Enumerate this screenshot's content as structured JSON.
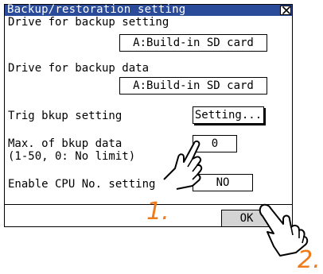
{
  "dialog": {
    "title": "Backup/restoration setting",
    "close_glyph": "×"
  },
  "settings": {
    "drive_backup_setting_label": "Drive for backup setting",
    "drive_backup_setting_value": "A:Build-in SD card",
    "drive_backup_data_label": "Drive for backup data",
    "drive_backup_data_value": "A:Build-in SD card",
    "trig_label": "Trig bkup setting",
    "trig_button": "Setting...",
    "max_label_line1": "Max. of bkup data",
    "max_label_line2": "(1-50, 0: No limit)",
    "max_value": "0",
    "enable_cpu_label": "Enable CPU No. setting",
    "enable_cpu_value": "NO"
  },
  "footer": {
    "ok_label": "OK"
  },
  "annotations": {
    "step1": "1.",
    "step2": "2.",
    "color": "#ee7a1a",
    "icon": "pointing-hand-icon"
  }
}
